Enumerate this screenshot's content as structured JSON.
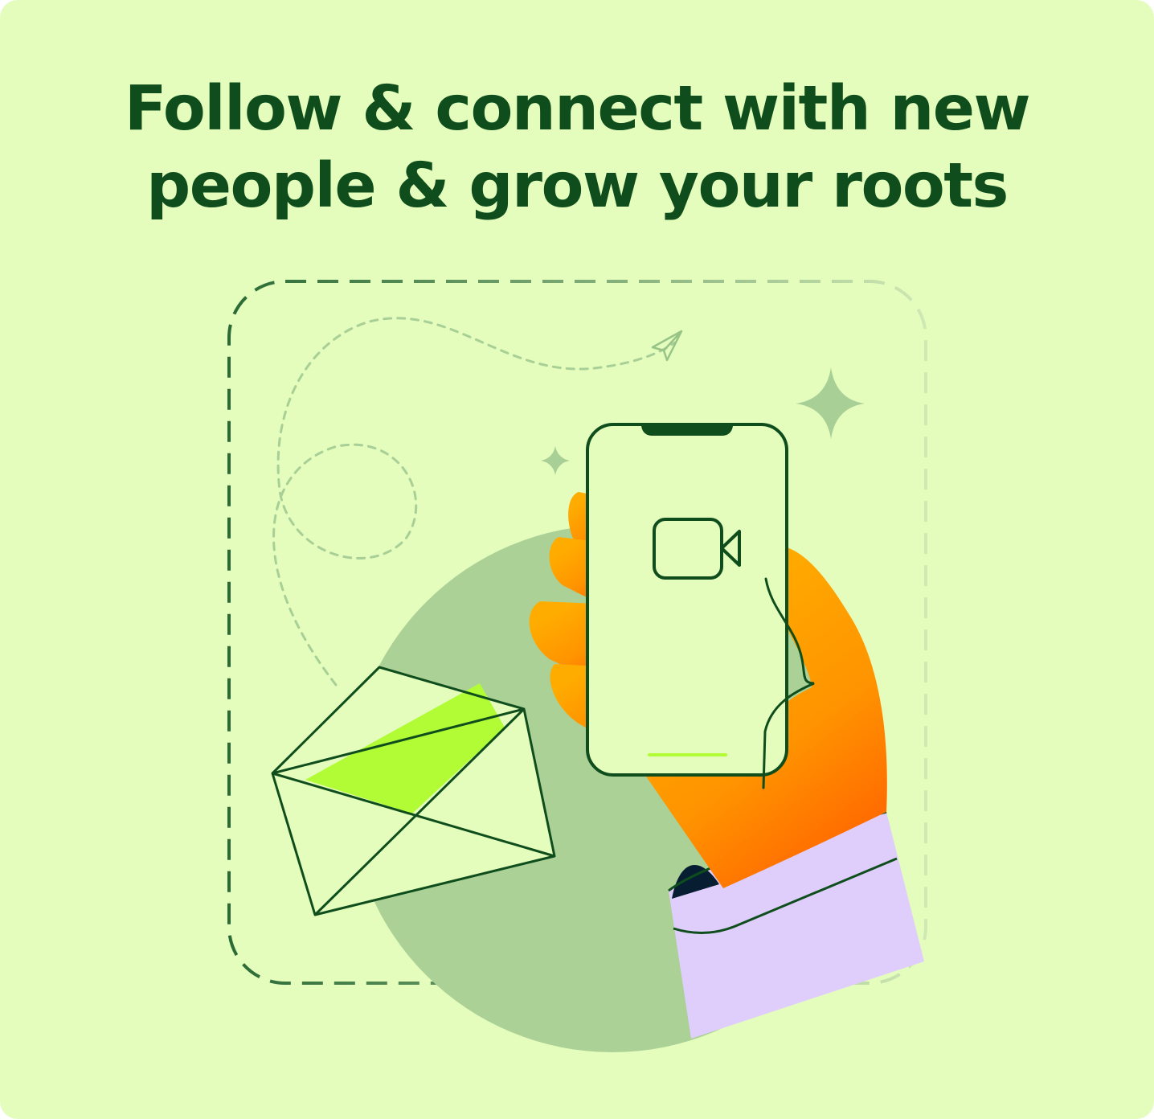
{
  "card": {
    "headline_lines": [
      "Follow & connect with new",
      "people & grow your roots"
    ]
  },
  "colors": {
    "background": "#e4fdbd",
    "headline": "#0f4e1c",
    "dark_green": "#0f4e1c",
    "circle": "#abd196",
    "letter_accent": "#b1fc35",
    "hand_orange_light": "#ffac00",
    "hand_orange_dark": "#ff6f00",
    "sleeve": "#dfcefc",
    "cuff_dark": "#071e32"
  },
  "icons": {
    "envelope": "envelope-icon",
    "phone": "smartphone-icon",
    "video": "video-camera-icon",
    "plane": "paper-plane-icon",
    "sparkle": "sparkle-icon"
  }
}
